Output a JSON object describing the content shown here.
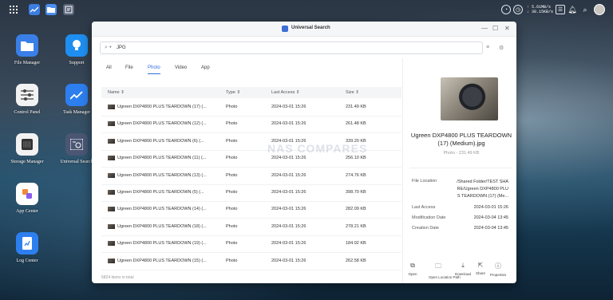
{
  "window": {
    "title": "Universal Search"
  },
  "search": {
    "value": "JPG"
  },
  "tabs": [
    {
      "label": "All"
    },
    {
      "label": "File"
    },
    {
      "label": "Photo"
    },
    {
      "label": "Video"
    },
    {
      "label": "App"
    }
  ],
  "active_tab": "Photo",
  "table": {
    "headers": {
      "name": "Name",
      "type": "Type",
      "last_access": "Last Access",
      "size": "Size"
    },
    "rows": [
      {
        "name": "Ugreen DXP4800 PLUS TEARDOWN (17) (...",
        "type": "Photo",
        "last_access": "2024-03-01 15:26",
        "size": "231.49 KB"
      },
      {
        "name": "Ugreen DXP4800 PLUS TEARDOWN (12) (...",
        "type": "Photo",
        "last_access": "2024-03-01 15:26",
        "size": "261.48 KB"
      },
      {
        "name": "Ugreen DXP4800 PLUS TEARDOWN (6) (...",
        "type": "Photo",
        "last_access": "2024-03-01 15:26",
        "size": "339.20 KB"
      },
      {
        "name": "Ugreen DXP4800 PLUS TEARDOWN (11) (...",
        "type": "Photo",
        "last_access": "2024-03-01 15:26",
        "size": "256.10 KB"
      },
      {
        "name": "Ugreen DXP4800 PLUS TEARDOWN (13) (...",
        "type": "Photo",
        "last_access": "2024-03-01 15:26",
        "size": "274.76 KB"
      },
      {
        "name": "Ugreen DXP4800 PLUS TEARDOWN (5) (...",
        "type": "Photo",
        "last_access": "2024-03-01 15:26",
        "size": "398.70 KB"
      },
      {
        "name": "Ugreen DXP4800 PLUS TEARDOWN (14) (...",
        "type": "Photo",
        "last_access": "2024-03-01 15:26",
        "size": "282.09 KB"
      },
      {
        "name": "Ugreen DXP4800 PLUS TEARDOWN (18) (...",
        "type": "Photo",
        "last_access": "2024-03-01 15:26",
        "size": "278.21 KB"
      },
      {
        "name": "Ugreen DXP4800 PLUS TEARDOWN (19) (...",
        "type": "Photo",
        "last_access": "2024-03-01 15:26",
        "size": "184.92 KB"
      },
      {
        "name": "Ugreen DXP4800 PLUS TEARDOWN (15) (...",
        "type": "Photo",
        "last_access": "2024-03-01 15:26",
        "size": "262.58 KB"
      }
    ],
    "footer": "5824 items in total"
  },
  "watermark": "NAS COMPARES",
  "details": {
    "name_line1": "Ugreen DXP4800 PLUS TEARDOWN",
    "name_line2": "(17) (Medium).jpg",
    "subtitle": "Photo - 231.49 KB",
    "file_location_label": "File Location",
    "file_location_lines": [
      "/Shared Folder/TEST SHA",
      "RE/Ugreen DXP4800 PLU",
      "S TEARDOWN (17) (Me..."
    ],
    "last_access_label": "Last Access",
    "last_access": "2024-03-01 15:26",
    "modification_label": "Modification Date",
    "modification": "2024-03-04 13:45",
    "creation_label": "Creation Date",
    "creation": "2024-03-04 13:45"
  },
  "actions": [
    {
      "label": "Open",
      "icon": "open-icon"
    },
    {
      "label": "Open Location Path",
      "icon": "folder-icon"
    },
    {
      "label": "Download",
      "icon": "download-icon"
    },
    {
      "label": "Share",
      "icon": "share-icon"
    },
    {
      "label": "Properties",
      "icon": "info-icon"
    }
  ],
  "topbar": {
    "upload": "↑ 5.61MB/s",
    "download": "↓ 38.15KB/s"
  },
  "desktop": [
    {
      "label": "File Manager"
    },
    {
      "label": "Support"
    },
    {
      "label": "Control Panel"
    },
    {
      "label": "Task Manager"
    },
    {
      "label": "Storage Manager"
    },
    {
      "label": "Universal Search"
    },
    {
      "label": "App Center"
    },
    {
      "label": "Log Center"
    }
  ],
  "colors": {
    "accent": "#2f6fe0",
    "window_bg": "#ffffff"
  }
}
